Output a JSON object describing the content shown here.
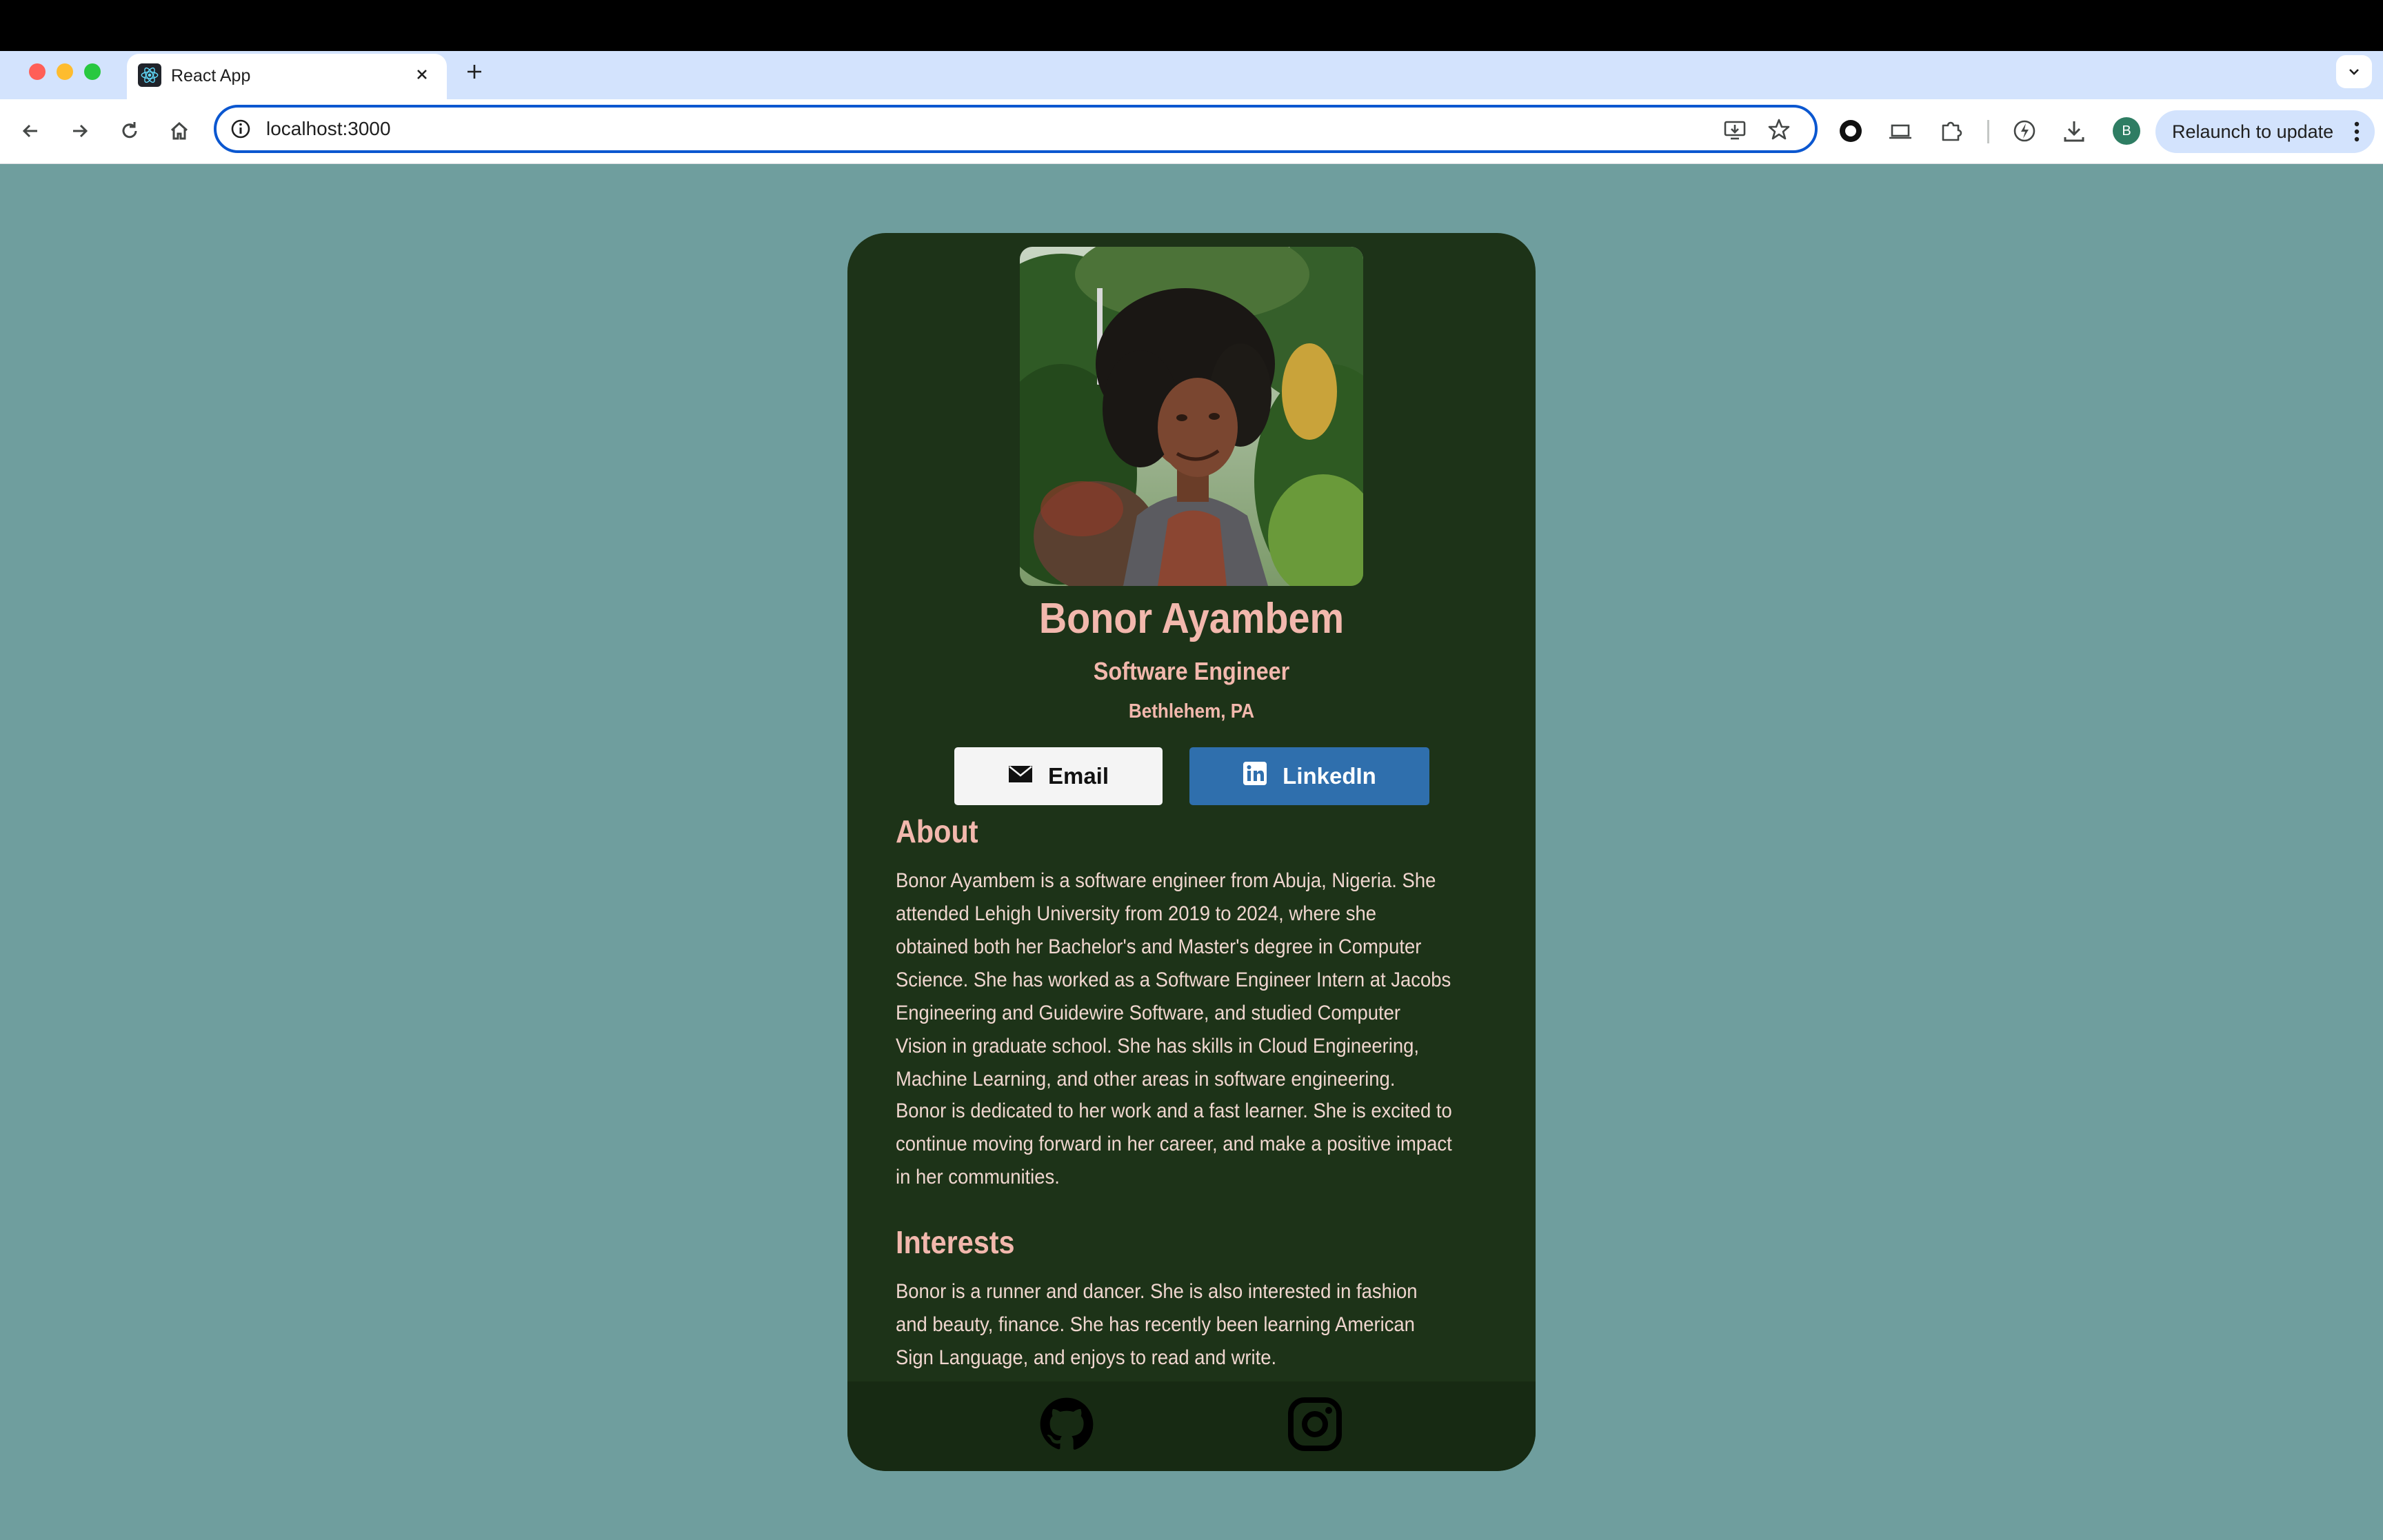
{
  "browser": {
    "tab": {
      "title": "React App",
      "favicon": "react-logo-icon"
    },
    "address_bar": {
      "url": "localhost:3000"
    },
    "profile_initial": "B",
    "relaunch_label": "Relaunch to update"
  },
  "profile": {
    "name": "Bonor Ayambem",
    "title": "Software Engineer",
    "location": "Bethlehem, PA",
    "buttons": {
      "email_label": "Email",
      "linkedin_label": "LinkedIn"
    },
    "about": {
      "heading": "About",
      "paragraphs": [
        "Bonor Ayambem is a software engineer from Abuja, Nigeria. She attended Lehigh University from 2019 to 2024, where she obtained both her Bachelor's and Master's degree in Computer Science. She has worked as a Software Engineer Intern at Jacobs Engineering and Guidewire Software, and studied Computer Vision in graduate school. She has skills in Cloud Engineering, Machine Learning, and other areas in software engineering.",
        "Bonor is dedicated to her work and a fast learner. She is excited to continue moving forward in her career, and make a positive impact in her communities."
      ]
    },
    "interests": {
      "heading": "Interests",
      "text": "Bonor is a runner and dancer. She is also interested in fashion and beauty, finance. She has recently been learning American Sign Language, and enjoys to read and write."
    },
    "footer_icons": [
      "github-icon",
      "instagram-icon"
    ]
  },
  "colors": {
    "page_background": "#6f9e9e",
    "card_background": "#1d3318",
    "footer_background": "#172a13",
    "heading_text": "#f2b8ad",
    "body_text": "#f0d6cf",
    "email_button": "#f4f4f4",
    "linkedin_button": "#2f6fad",
    "browser_accent": "#0b57d0"
  }
}
